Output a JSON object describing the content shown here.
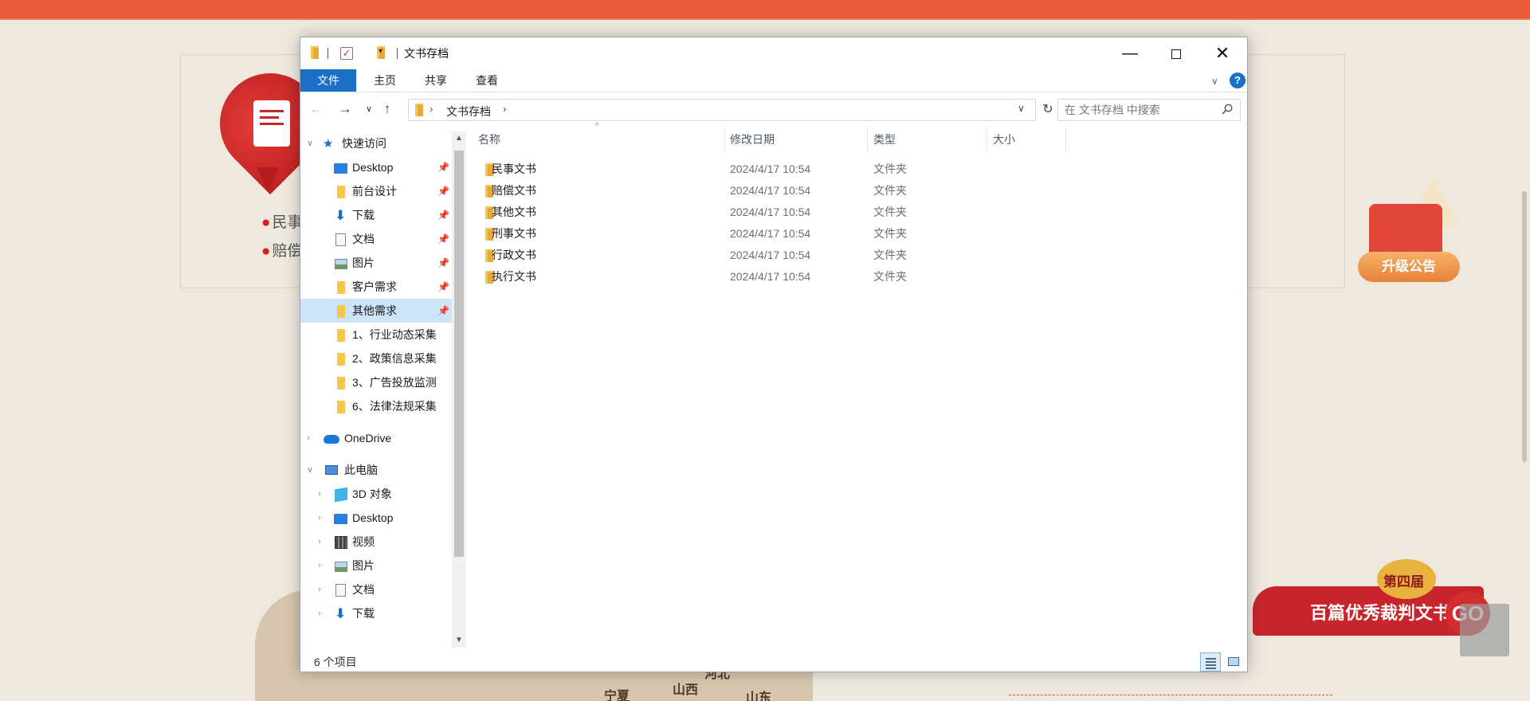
{
  "background": {
    "list_items": [
      "民事",
      "赔偿"
    ],
    "notice_label": "升级公告",
    "award_badge": "第四届",
    "award_text": "百篇优秀裁判文书",
    "award_go": "GO",
    "map_labels": [
      "宁夏",
      "山西",
      "河北",
      "山东"
    ]
  },
  "window": {
    "title": "文书存档",
    "controls": {
      "minimize": "—",
      "maximize": "",
      "close": "✕"
    },
    "ribbon_tabs": [
      "文件",
      "主页",
      "共享",
      "查看"
    ],
    "help": "?"
  },
  "address_bar": {
    "crumb": "文书存档",
    "search_placeholder": "在 文书存档 中搜索"
  },
  "nav_pane": {
    "quick_access": "快速访问",
    "quick_items": [
      {
        "label": "Desktop",
        "icon": "desktop-icon"
      },
      {
        "label": "前台设计",
        "icon": "folder-icon"
      },
      {
        "label": "下载",
        "icon": "download-icon"
      },
      {
        "label": "文档",
        "icon": "document-icon"
      },
      {
        "label": "图片",
        "icon": "pictures-icon"
      },
      {
        "label": "客户需求",
        "icon": "folder-icon"
      },
      {
        "label": "其他需求",
        "icon": "folder-icon"
      },
      {
        "label": "1、行业动态采集",
        "icon": "folder-icon"
      },
      {
        "label": "2、政策信息采集",
        "icon": "folder-icon"
      },
      {
        "label": "3、广告投放监测",
        "icon": "folder-icon"
      },
      {
        "label": "6、法律法规采集",
        "icon": "folder-icon"
      }
    ],
    "onedrive": "OneDrive",
    "this_pc": "此电脑",
    "pc_items": [
      {
        "label": "3D 对象",
        "icon": "3d-objects-icon"
      },
      {
        "label": "Desktop",
        "icon": "desktop-icon"
      },
      {
        "label": "视频",
        "icon": "video-icon"
      },
      {
        "label": "图片",
        "icon": "pictures-icon"
      },
      {
        "label": "文档",
        "icon": "document-icon"
      },
      {
        "label": "下载",
        "icon": "download-icon"
      }
    ]
  },
  "file_list": {
    "columns": [
      "名称",
      "修改日期",
      "类型",
      "大小"
    ],
    "rows": [
      {
        "name": "民事文书",
        "date": "2024/4/17 10:54",
        "type": "文件夹"
      },
      {
        "name": "赔偿文书",
        "date": "2024/4/17 10:54",
        "type": "文件夹"
      },
      {
        "name": "其他文书",
        "date": "2024/4/17 10:54",
        "type": "文件夹"
      },
      {
        "name": "刑事文书",
        "date": "2024/4/17 10:54",
        "type": "文件夹"
      },
      {
        "name": "行政文书",
        "date": "2024/4/17 10:54",
        "type": "文件夹"
      },
      {
        "name": "执行文书",
        "date": "2024/4/17 10:54",
        "type": "文件夹"
      }
    ]
  },
  "status_bar": {
    "count": "6 个项目"
  },
  "colors": {
    "accent": "#1a6fc7",
    "selection": "#cce4f7",
    "folder": "#f6c64a",
    "page_bg": "#efe9dd",
    "page_red": "#ea5a3a"
  }
}
